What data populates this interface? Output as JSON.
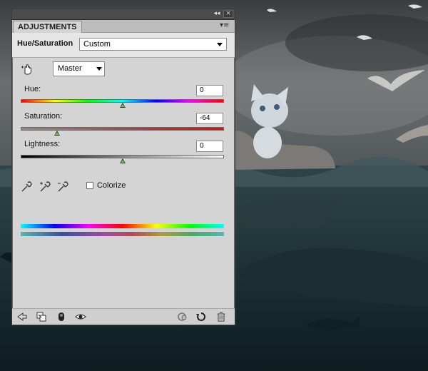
{
  "panel": {
    "tab_label": "ADJUSTMENTS",
    "collapse_glyph": "◂◂",
    "close_glyph": "×",
    "menu_glyph": "▾≡",
    "adjustment_name": "Hue/Saturation",
    "preset_value": "Custom",
    "channel_value": "Master",
    "sliders": {
      "hue": {
        "label": "Hue:",
        "value": "0",
        "position": 0.5
      },
      "saturation": {
        "label": "Saturation:",
        "value": "-64",
        "position": 0.18
      },
      "lightness": {
        "label": "Lightness:",
        "value": "0",
        "position": 0.5
      }
    },
    "colorize_label": "Colorize",
    "colorize_checked": false,
    "footer_icons": [
      "back-arrow-icon",
      "clip-to-layer-icon",
      "mask-icon",
      "visibility-eye-icon",
      "reset-previous-icon",
      "reset-icon",
      "trash-icon"
    ]
  },
  "colors": {
    "panel_bg": "#d4d4d4",
    "titlebar_bg": "#4b4b4b",
    "thumb_fill": "#79b65a"
  }
}
